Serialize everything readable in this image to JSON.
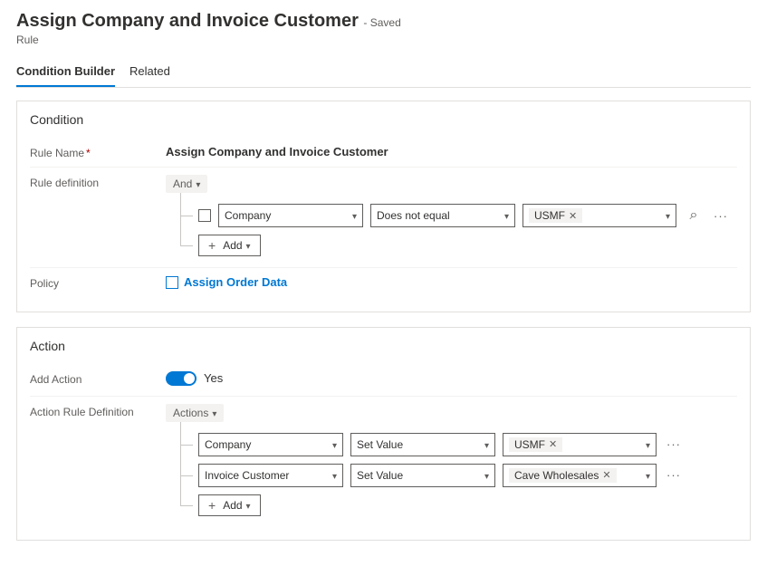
{
  "header": {
    "title": "Assign Company and Invoice Customer",
    "saved_suffix": "- Saved",
    "entity_type": "Rule"
  },
  "tabs": {
    "condition_builder": "Condition Builder",
    "related": "Related"
  },
  "condition_panel": {
    "title": "Condition",
    "rule_name_label": "Rule Name",
    "rule_name_value": "Assign Company and Invoice Customer",
    "rule_def_label": "Rule definition",
    "grouper": "And",
    "row1": {
      "field": "Company",
      "operator": "Does not equal",
      "value": "USMF"
    },
    "add": "Add",
    "policy_label": "Policy",
    "policy_value": "Assign Order Data"
  },
  "action_panel": {
    "title": "Action",
    "add_action_label": "Add Action",
    "add_action_value": "Yes",
    "action_rule_def_label": "Action Rule Definition",
    "grouper": "Actions",
    "row1": {
      "field": "Company",
      "operator": "Set Value",
      "value": "USMF"
    },
    "row2": {
      "field": "Invoice Customer",
      "operator": "Set Value",
      "value": "Cave Wholesales"
    },
    "add": "Add"
  }
}
